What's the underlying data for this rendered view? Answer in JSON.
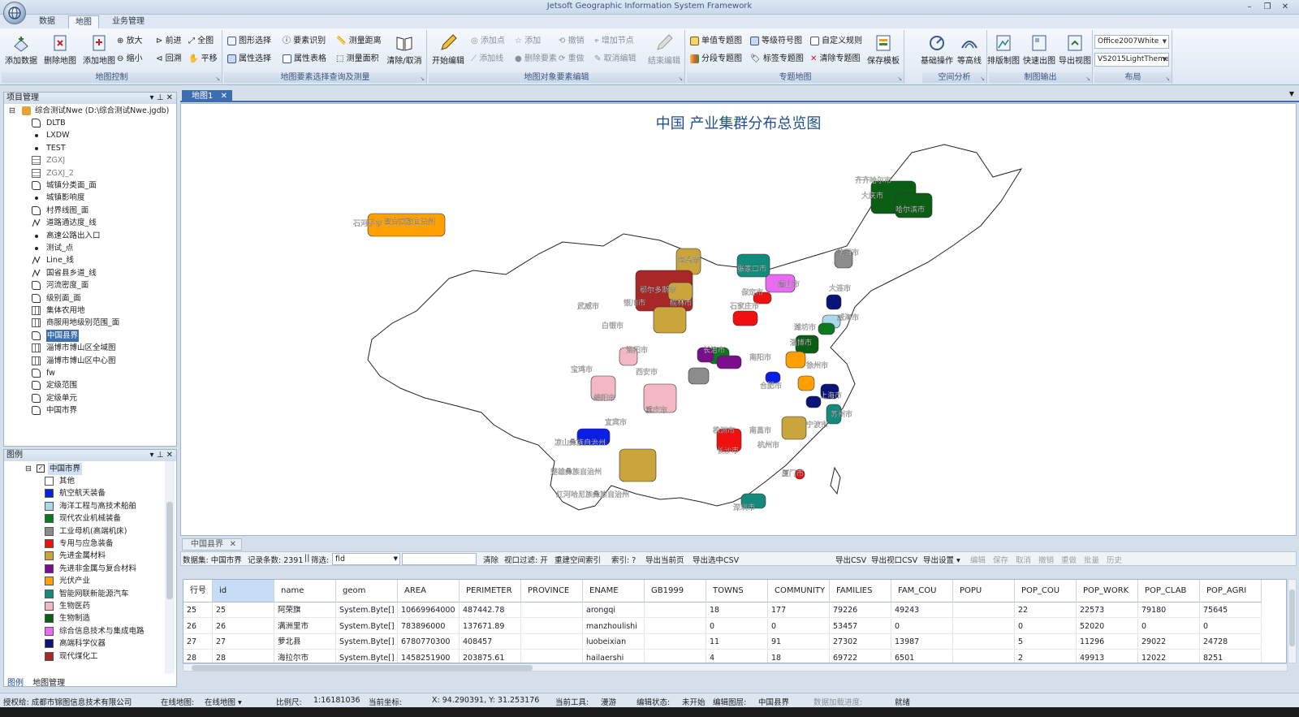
{
  "window": {
    "title": "Jetsoft Geographic Information System Framework",
    "controls": [
      "–",
      "❐",
      "✕"
    ]
  },
  "menu_tabs": [
    "数据",
    "地图",
    "业务管理"
  ],
  "active_menu_tab": "地图",
  "ribbon": {
    "groups": [
      {
        "label": "地图控制"
      },
      {
        "label": "地图要素选择查询及测量"
      },
      {
        "label": "地图对象要素编辑"
      },
      {
        "label": "专题地图"
      },
      {
        "label": "空间分析"
      },
      {
        "label": "制图输出"
      },
      {
        "label": "布局"
      }
    ],
    "map_control": {
      "add_data": "添加数据",
      "delete_map": "删除地图",
      "add_map": "添加地图",
      "zoom_in": "放大",
      "forward": "前进",
      "full_extent": "全图",
      "zoom_out": "缩小",
      "back": "回溯",
      "pan": "平移"
    },
    "query": {
      "shape_select": "图形选择",
      "identify": "要素识别",
      "measure_distance": "测量距离",
      "attr_select": "属性选择",
      "attr_table": "属性表格",
      "measure_area": "测量面积",
      "clear_cancel": "清除/取消"
    },
    "edit": {
      "start_edit": "开始编辑",
      "add_point": "添加点",
      "add": "添加",
      "undo": "撤销",
      "add_node": "增加节点",
      "end_edit": "结束编辑",
      "add_line": "添加线",
      "delete_feature": "删除要素",
      "redo": "重做",
      "cancel_edit": "取消编辑"
    },
    "thematic": {
      "unique_value": "单值专题图",
      "graduated_symbol": "等级符号图",
      "custom_rule": "自定义规则",
      "class_break": "分段专题图",
      "label_map": "标签专题图",
      "clear_thematic": "清除专题图",
      "save_template": "保存模板"
    },
    "spatial": {
      "basic_ops": "基础操作",
      "contour": "等高线"
    },
    "output": {
      "layout": "排版制图",
      "quick_map": "快速出图",
      "export_view": "导出视图"
    },
    "layout_combos": {
      "theme1": "Office2007White",
      "theme2": "VS2015LightTheme"
    }
  },
  "project_panel": {
    "title": "项目管理",
    "root": "综合测试Nwe (D:\\综合测试Nwe.jgdb)",
    "layers": [
      {
        "name": "DLTB",
        "icon": "polygon-icon",
        "style": ""
      },
      {
        "name": "LXDW",
        "icon": "point-icon",
        "style": ""
      },
      {
        "name": "TEST",
        "icon": "point-icon",
        "style": ""
      },
      {
        "name": "ZGXJ",
        "icon": "table-icon",
        "style": "gray"
      },
      {
        "name": "ZGXJ_2",
        "icon": "table-icon",
        "style": "gray"
      },
      {
        "name": "城镇分类面_面",
        "icon": "polygon-icon",
        "style": ""
      },
      {
        "name": "城镇影响度",
        "icon": "point-icon",
        "style": ""
      },
      {
        "name": "村界线图_面",
        "icon": "polygon-icon",
        "style": ""
      },
      {
        "name": "道路通达度_线",
        "icon": "line-icon",
        "style": ""
      },
      {
        "name": "高速公路出入口",
        "icon": "point-icon",
        "style": ""
      },
      {
        "name": "测试_点",
        "icon": "point-icon",
        "style": ""
      },
      {
        "name": "Line_线",
        "icon": "line-icon",
        "style": ""
      },
      {
        "name": "国省县乡道_线",
        "icon": "line-icon",
        "style": ""
      },
      {
        "name": "河流密度_面",
        "icon": "polygon-icon",
        "style": ""
      },
      {
        "name": "级别面_面",
        "icon": "polygon-icon",
        "style": ""
      },
      {
        "name": "集体农用地",
        "icon": "raster-icon",
        "style": ""
      },
      {
        "name": "商服用地级别范围_面",
        "icon": "raster-icon",
        "style": ""
      },
      {
        "name": "中国县界",
        "icon": "polygon-icon",
        "style": "sel"
      },
      {
        "name": "淄博市博山区全域图",
        "icon": "raster-icon",
        "style": ""
      },
      {
        "name": "淄博市博山区中心图",
        "icon": "raster-icon",
        "style": ""
      },
      {
        "name": "fw",
        "icon": "polygon-icon",
        "style": ""
      },
      {
        "name": "定级范围",
        "icon": "polygon-icon",
        "style": ""
      },
      {
        "name": "定级单元",
        "icon": "polygon-icon",
        "style": ""
      },
      {
        "name": "中国市界",
        "icon": "polygon-icon",
        "style": ""
      }
    ]
  },
  "legend_panel": {
    "title": "图例",
    "layer": "中国市界",
    "items": [
      {
        "label": "其他",
        "color": "#ffffff"
      },
      {
        "label": "航空航天装备",
        "color": "#0a1ee6"
      },
      {
        "label": "海洋工程与高技术船舶",
        "color": "#a8d8ea"
      },
      {
        "label": "现代农业机械装备",
        "color": "#0b7a1e"
      },
      {
        "label": "工业母机(高端机床)",
        "color": "#8c8c8c"
      },
      {
        "label": "专用与应急装备",
        "color": "#f01010"
      },
      {
        "label": "先进金属材料",
        "color": "#c9a53c"
      },
      {
        "label": "先进非金属与复合材料",
        "color": "#7a0f8c"
      },
      {
        "label": "光伏产业",
        "color": "#ffa000"
      },
      {
        "label": "智能网联新能源汽车",
        "color": "#138a7a"
      },
      {
        "label": "生物医药",
        "color": "#f2b8c6"
      },
      {
        "label": "生物制造",
        "color": "#0a5f14"
      },
      {
        "label": "综合信息技术与集成电路",
        "color": "#e86bf2"
      },
      {
        "label": "高端科学仪器",
        "color": "#0a1478"
      },
      {
        "label": "现代煤化工",
        "color": "#a82828"
      }
    ],
    "tabs": [
      "图例",
      "地图管理"
    ]
  },
  "document_tab": "地图1",
  "map": {
    "title": "中国 产业集群分布总览图",
    "labels": [
      "齐齐哈尔市",
      "大庆市",
      "哈尔滨市",
      "石河子市",
      "昌吉回族自治州",
      "包头市",
      "鄂尔多斯市",
      "榆林市",
      "银川市",
      "武威市",
      "白银市",
      "张家口市",
      "保定市",
      "唐山市",
      "石家庄市",
      "沈阳市",
      "大连市",
      "威海市",
      "潍坊市",
      "淄博市",
      "长治市",
      "洛阳市",
      "西安市",
      "宝鸡市",
      "南阳市",
      "绵阳市",
      "重庆市",
      "宜宾市",
      "合肥市",
      "徐州市",
      "上海市",
      "苏州市",
      "杭州市",
      "南昌市",
      "株洲市",
      "长沙市",
      "凉山彝族自治州",
      "楚雄彝族自治州",
      "红河哈尼族彝族自治州",
      "深圳市",
      "厦门市",
      "宁波市"
    ]
  },
  "attr_table": {
    "tab": "中国县界",
    "toolbar": {
      "dataset": "数据集: 中国市界",
      "count": "记录条数: 2391",
      "sep": "||",
      "filter_label": "筛选:",
      "filter_field": "fid",
      "clear": "清除",
      "viewport_filter": "视口过滤: 开",
      "rebuild_index": "重建空间索引",
      "index": "索引: ?",
      "export_current": "导出当前页",
      "export_selected": "导出选中CSV",
      "export_csv": "导出CSV",
      "export_view_csv": "导出视口CSV",
      "export_settings": "导出设置 ▾",
      "edit": "编辑",
      "save": "保存",
      "cancel": "取消",
      "undo": "撤销",
      "redo": "重做",
      "batch": "批量",
      "history": "历史"
    },
    "columns": [
      "行号",
      "id",
      "name",
      "geom",
      "AREA",
      "PERIMETER",
      "PROVINCE",
      "ENAME",
      "GB1999",
      "TOWNS",
      "COMMUNITY",
      "FAMILIES",
      "FAM_COU",
      "POPU",
      "POP_COU",
      "POP_WORK",
      "POP_CLAB",
      "POP_AGRI"
    ],
    "rows": [
      [
        "25",
        "25",
        "阿荣旗",
        "System.Byte[]",
        "10669964000",
        "487442.78",
        "",
        "arongqi",
        "",
        "18",
        "177",
        "79226",
        "49243",
        "",
        "22",
        "22573",
        "79180",
        "75645"
      ],
      [
        "26",
        "26",
        "满洲里市",
        "System.Byte[]",
        "783896000",
        "137671.89",
        "",
        "manzhoulishi",
        "",
        "0",
        "0",
        "53457",
        "0",
        "",
        "0",
        "52020",
        "0",
        "0"
      ],
      [
        "27",
        "27",
        "萝北县",
        "System.Byte[]",
        "6780770300",
        "408457",
        "",
        "luobeixian",
        "",
        "11",
        "91",
        "27302",
        "13987",
        "",
        "5",
        "11296",
        "29022",
        "24728"
      ],
      [
        "28",
        "28",
        "海拉尔市",
        "System.Byte[]",
        "1458251900",
        "203875.61",
        "",
        "hailaershi",
        "",
        "4",
        "18",
        "69722",
        "6501",
        "",
        "2",
        "49913",
        "12022",
        "8251"
      ]
    ]
  },
  "status_bar": {
    "license": "授权给: 成都市锦图信息技术有限公司",
    "online_map_label": "在线地图:",
    "online_map_value": "在线地图 ▾",
    "scale_label": "比例尺:",
    "scale_value": "1:16181036",
    "coord_label": "当前坐标:",
    "coord_value": "X: 94.290391, Y: 31.253176",
    "tool_label": "当前工具:",
    "tool_value": "漫游",
    "edit_state_label": "编辑状态:",
    "edit_state_value": "未开始",
    "edit_layer_label": "编辑图层:",
    "edit_layer_value": "中国县界",
    "load_progress": "数据加载进度:",
    "ready": "就绪"
  }
}
